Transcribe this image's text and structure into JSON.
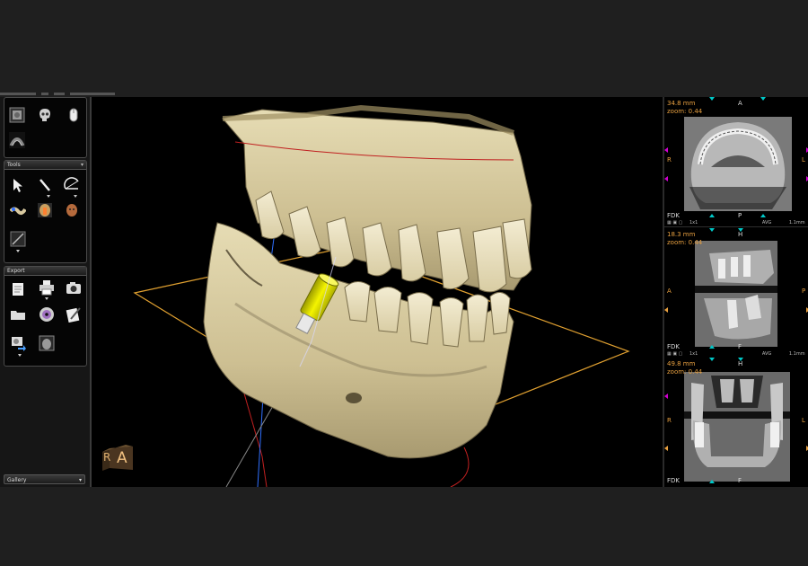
{
  "left_panel": {
    "tools": {
      "title": "Tools"
    },
    "export": {
      "title": "Export"
    },
    "gallery": {
      "label": "Gallery"
    }
  },
  "viewport": {
    "orientation_cube": {
      "face_left": "R",
      "face_front": "A"
    },
    "implant_color": "#e6e600",
    "bone_color": "#d8cfa6",
    "plane_color": "#e0a030"
  },
  "slices": [
    {
      "name": "axial",
      "dimension": "34.8 mm",
      "zoom": "zoom: 0.44",
      "top_label": "A",
      "bottom_label": "P",
      "left_label": "R",
      "right_label": "L",
      "filter": "FDK"
    },
    {
      "name": "sagittal",
      "dimension": "18.3 mm",
      "zoom": "zoom: 0.44",
      "top_label": "H",
      "bottom_label": "F",
      "left_label": "A",
      "right_label": "P",
      "filter": "FDK"
    },
    {
      "name": "coronal",
      "dimension": "49.8 mm",
      "zoom": "zoom: 0.44",
      "top_label": "H",
      "bottom_label": "F",
      "left_label": "R",
      "right_label": "L",
      "filter": "FDK"
    }
  ],
  "slice_controls": {
    "ratio": "1x1",
    "mode": "AVG",
    "thickness": "1.1mm"
  }
}
